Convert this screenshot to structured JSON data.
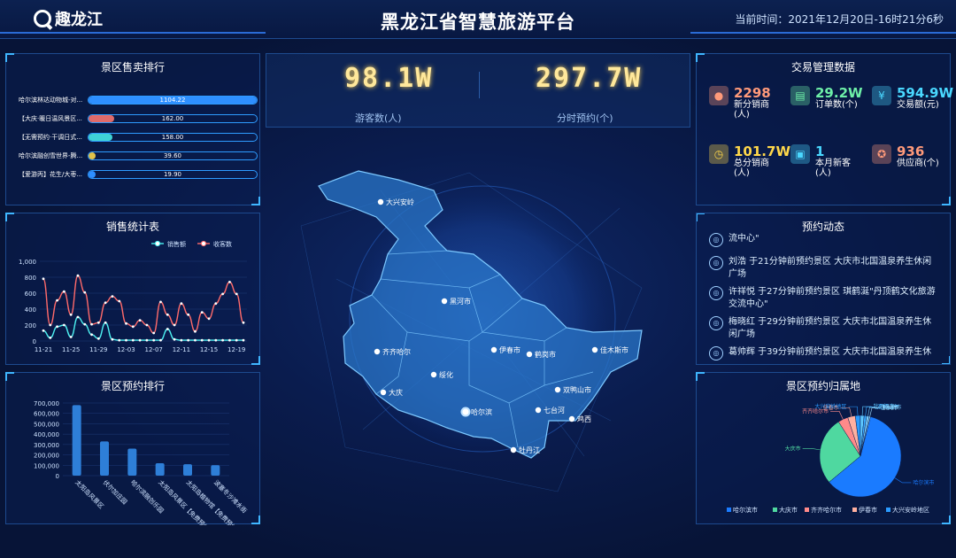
{
  "header": {
    "logo_text": "趣龙江",
    "title": "黑龙江省智慧旅游平台",
    "time_label": "当前时间：2021年12月20日-16时21分6秒"
  },
  "ranking": {
    "title": "景区售卖排行",
    "items": [
      {
        "name": "哈尔滨林达动物城-对...",
        "value": "1104.22",
        "fraction": 1.0,
        "color": "#2e8fff"
      },
      {
        "name": "【大庆·暖日温风景区...",
        "value": "162.00",
        "fraction": 0.15,
        "color": "#e06a6a"
      },
      {
        "name": "【无需预约·干调日式...",
        "value": "158.00",
        "fraction": 0.14,
        "color": "#3fd2d6"
      },
      {
        "name": "哈尔滨融创雪世界-腾...",
        "value": "39.60",
        "fraction": 0.04,
        "color": "#e0c24a"
      },
      {
        "name": "【爱游丙】花生/大枣...",
        "value": "19.90",
        "fraction": 0.02,
        "color": "#2e8fff"
      }
    ]
  },
  "stats": {
    "visitors_value": "98.1W",
    "visitors_label": "游客数(人)",
    "booking_value": "297.7W",
    "booking_label": "分时预约(个)"
  },
  "trade": {
    "title": "交易管理数据",
    "items": [
      {
        "value": "2298",
        "label": "新分销商(人)",
        "color": "#ff9a7a",
        "icon": "person-icon"
      },
      {
        "value": "29.2W",
        "label": "订单数(个)",
        "color": "#6ef0a8",
        "icon": "document-icon"
      },
      {
        "value": "594.9W",
        "label": "交易额(元)",
        "color": "#4ad8ff",
        "icon": "yen-icon"
      },
      {
        "value": "101.7W",
        "label": "总分销商(人)",
        "color": "#ffd84a",
        "icon": "clock-icon"
      },
      {
        "value": "1",
        "label": "本月新客(人)",
        "color": "#4ad8ff",
        "icon": "id-card-icon"
      },
      {
        "value": "936",
        "label": "供应商(个)",
        "color": "#ff9a7a",
        "icon": "medal-icon"
      }
    ]
  },
  "sales_chart": {
    "title": "销售统计表"
  },
  "booking_chart": {
    "title": "景区预约排行"
  },
  "feed": {
    "title": "预约动态",
    "items": [
      {
        "text": "流中心\""
      },
      {
        "text": "刘浩 于21分钟前预约景区 大庆市北国温泉养生休闲广场"
      },
      {
        "text": "许祥悦 于27分钟前预约景区 琪鹤涎\"丹顶鹤文化旅游交流中心\""
      },
      {
        "text": "梅晓红 于29分钟前预约景区 大庆市北国温泉养生休闲广场"
      },
      {
        "text": "葛帅辉 于39分钟前预约景区 大庆市北国温泉养生休"
      }
    ]
  },
  "pie_panel": {
    "title": "景区预约归属地"
  },
  "map": {
    "cities": [
      "大兴安岭",
      "黑河市",
      "伊春市",
      "鹤岗市",
      "佳木斯市",
      "齐齐哈尔",
      "绥化",
      "大庆",
      "哈尔滨",
      "双鸭山市",
      "七台河",
      "鸡西",
      "牡丹江"
    ]
  },
  "chart_data": [
    {
      "type": "line",
      "title": "销售统计表",
      "x": [
        "11-21",
        "11-22",
        "11-23",
        "11-24",
        "11-25",
        "11-26",
        "11-27",
        "11-28",
        "11-29",
        "11-30",
        "12-01",
        "12-02",
        "12-03",
        "12-04",
        "12-05",
        "12-06",
        "12-07",
        "12-08",
        "12-09",
        "12-10",
        "12-11",
        "12-12",
        "12-13",
        "12-14",
        "12-15",
        "12-16",
        "12-17",
        "12-18",
        "12-19",
        "12-20"
      ],
      "x_ticks": [
        "11-21",
        "11-25",
        "11-29",
        "12-03",
        "12-07",
        "12-11",
        "12-15",
        "12-19"
      ],
      "series": [
        {
          "name": "销售额",
          "color": "#4cf0f0",
          "values": [
            130,
            40,
            180,
            200,
            50,
            300,
            210,
            80,
            30,
            230,
            20,
            10,
            10,
            10,
            10,
            10,
            10,
            10,
            150,
            20,
            10,
            10,
            10,
            10,
            10,
            10,
            10,
            10,
            10,
            10
          ]
        },
        {
          "name": "收客数",
          "color": "#ff6a6a",
          "values": [
            780,
            200,
            510,
            620,
            330,
            820,
            610,
            210,
            230,
            480,
            560,
            500,
            220,
            180,
            260,
            200,
            100,
            490,
            330,
            200,
            470,
            330,
            120,
            360,
            280,
            470,
            590,
            740,
            590,
            230
          ]
        }
      ],
      "ylim": [
        0,
        1000
      ],
      "yticks": [
        "0",
        "200",
        "400",
        "600",
        "800",
        "1,000"
      ],
      "legend": "top-right"
    },
    {
      "type": "bar",
      "title": "景区预约排行",
      "categories": [
        "太阳岛风景区",
        "伏尔加庄园",
        "哈尔滨融创乐园",
        "太阳岛风景区【免费预约】",
        "太阳岛植物馆【免费预约】",
        "波塞冬沙滩水街"
      ],
      "values": [
        680000,
        330000,
        260000,
        120000,
        110000,
        100000
      ],
      "ylim": [
        0,
        700000
      ],
      "yticks": [
        "0",
        "100,000",
        "200,000",
        "300,000",
        "400,000",
        "500,000",
        "600,000",
        "700,000"
      ]
    },
    {
      "type": "pie",
      "title": "景区预约归属地",
      "categories": [
        "哈尔滨市",
        "大庆市",
        "齐齐哈尔市",
        "伊春市",
        "大兴安岭地区",
        "牡丹江市",
        "双鸭山市",
        "佳木斯市",
        "鹤岗市"
      ],
      "values": [
        60,
        27,
        4,
        3,
        2,
        1.5,
        1,
        1,
        0.5
      ],
      "colors": [
        "#1a7bff",
        "#4fd8a0",
        "#ff8a8a",
        "#ffb0a0",
        "#2a9bff",
        "#5ec8ff",
        "#3aaaff",
        "#7ad0ff",
        "#a0e0ff"
      ],
      "legend": [
        "哈尔滨市",
        "大庆市",
        "齐齐哈尔市",
        "伊春市",
        "大兴安岭地区"
      ],
      "legend_position": "bottom"
    }
  ]
}
